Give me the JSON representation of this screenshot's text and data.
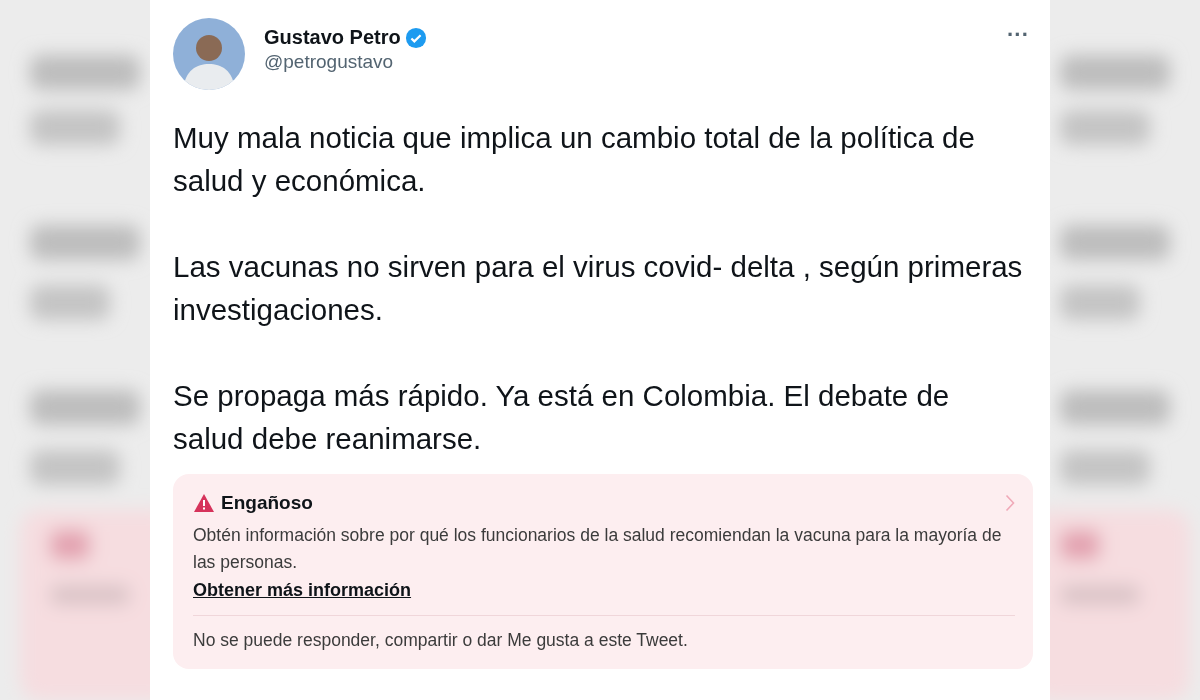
{
  "author": {
    "name": "Gustavo Petro",
    "verified": true,
    "handle": "@petrogustavo"
  },
  "more_button": "···",
  "paragraphs": [
    "Muy mala noticia que implica un cambio total de la política de salud y económica.",
    "Las vacunas no sirven para el virus covid- delta , según primeras investigaciones.",
    "Se propaga más rápido. Ya está en Colombia. El debate de salud debe reanimarse."
  ],
  "notice": {
    "title": "Engañoso",
    "body": "Obtén información sobre por qué los funcionarios de la salud recomiendan la vacuna para la mayoría de las personas.",
    "link": "Obtener más información",
    "footer": "No se puede responder, compartir o dar Me gusta a este Tweet."
  }
}
